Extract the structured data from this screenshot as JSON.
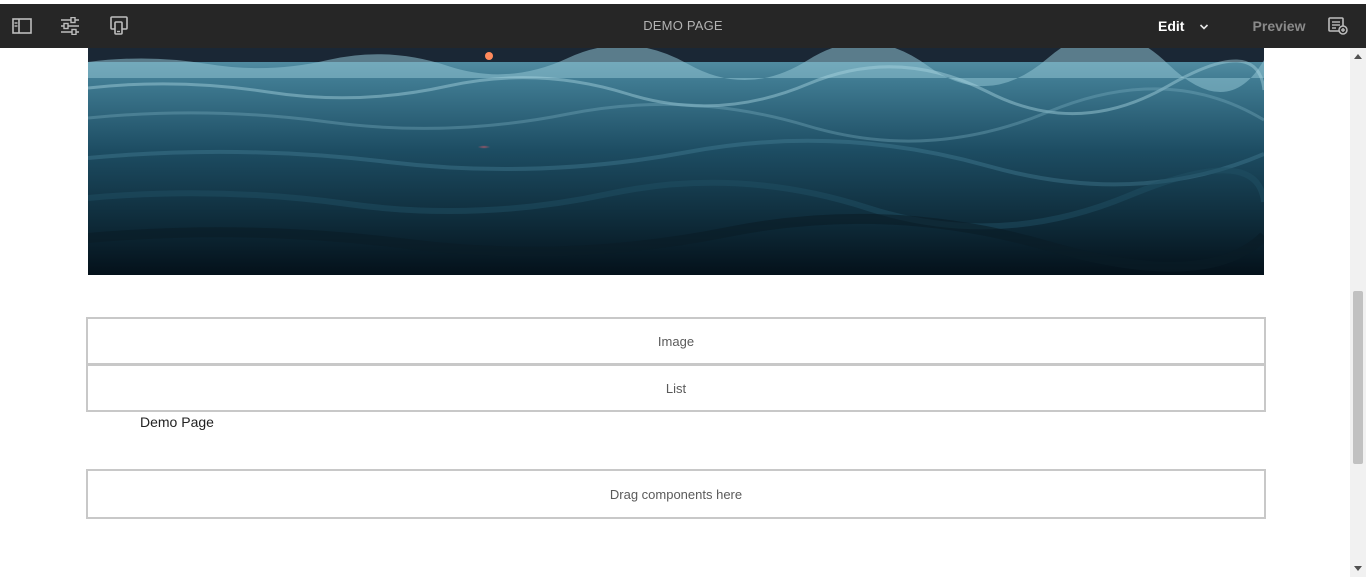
{
  "toolbar": {
    "title": "DEMO PAGE",
    "edit_label": "Edit",
    "preview_label": "Preview",
    "icons": {
      "side_panel": "side-panel-icon",
      "page_properties": "page-properties-icon",
      "emulator": "emulator-icon",
      "annotate": "annotate-icon",
      "mode_dropdown": "chevron-down-icon"
    }
  },
  "main": {
    "placeholders": [
      "Image",
      "List"
    ],
    "page_title": "Demo Page",
    "drop_zone": "Drag components here"
  },
  "colors": {
    "toolbar_bg": "#262626",
    "placeholder_border": "#c8c8c8",
    "scrollbar_thumb": "#c1c1c1"
  }
}
